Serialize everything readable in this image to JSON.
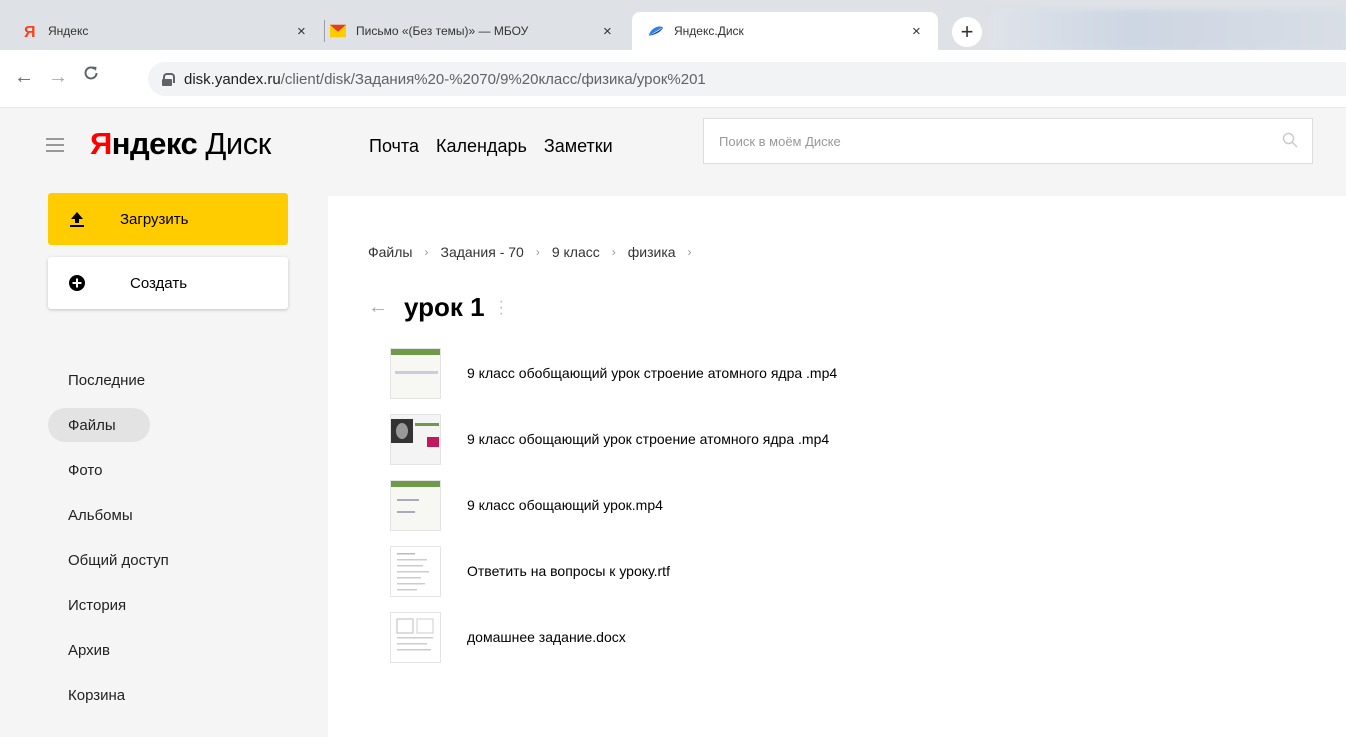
{
  "browser": {
    "tabs": [
      {
        "title": "Яндекс",
        "favicon": "yandex-ya-icon",
        "close": "×"
      },
      {
        "title": "Письмо «(Без темы)» — МБОУ",
        "favicon": "mail-envelope-icon",
        "close": "×"
      },
      {
        "title": "Яндекс.Диск",
        "favicon": "disk-icon",
        "close": "×"
      }
    ],
    "new_tab": "+",
    "url_host": "disk.yandex.ru",
    "url_path": "/client/disk/Задания%20-%2070/9%20класс/физика/урок%201"
  },
  "header": {
    "logo_part1": "Я",
    "logo_part2": "ндекс",
    "logo_part3": " Диск",
    "nav": [
      "Почта",
      "Календарь",
      "Заметки"
    ],
    "search_placeholder": "Поиск в моём Диске"
  },
  "sidebar": {
    "upload_label": "Загрузить",
    "create_label": "Создать",
    "items": [
      {
        "label": "Последние",
        "active": false
      },
      {
        "label": "Файлы",
        "active": true
      },
      {
        "label": "Фото",
        "active": false
      },
      {
        "label": "Альбомы",
        "active": false
      },
      {
        "label": "Общий доступ",
        "active": false
      },
      {
        "label": "История",
        "active": false
      },
      {
        "label": "Архив",
        "active": false
      },
      {
        "label": "Корзина",
        "active": false
      }
    ]
  },
  "main": {
    "breadcrumbs": [
      "Файлы",
      "Задания - 70",
      "9 класс",
      "физика"
    ],
    "breadcrumb_sep": "›",
    "title": "урок 1",
    "files": [
      {
        "name": "9 класс обобщающий урок строение атомного ядра .mp4",
        "kind": "video-slide"
      },
      {
        "name": "9 класс обощающий урок строение атомного ядра .mp4",
        "kind": "video-portrait"
      },
      {
        "name": "9 класс обощающий урок.mp4",
        "kind": "video-formula"
      },
      {
        "name": "Ответить на вопросы к уроку.rtf",
        "kind": "document"
      },
      {
        "name": "домашнее задание.docx",
        "kind": "document-table"
      }
    ]
  },
  "colors": {
    "accent_yellow": "#ffcc00",
    "logo_red": "#ff0000"
  }
}
